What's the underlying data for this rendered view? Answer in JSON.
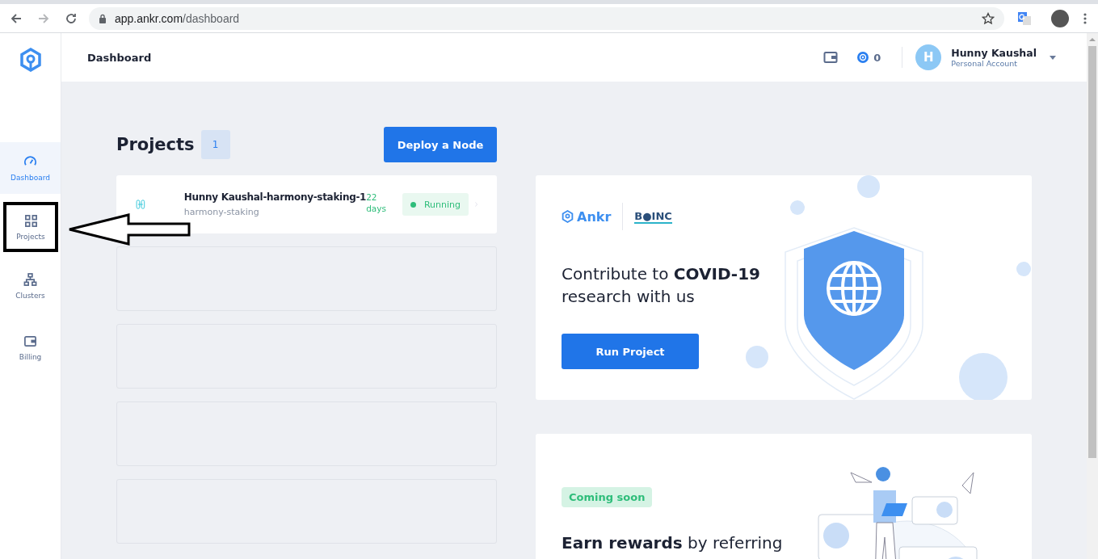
{
  "browser": {
    "url_host": "app.ankr.com",
    "url_path": "/dashboard"
  },
  "sidebar": {
    "items": [
      {
        "label": "Dashboard",
        "kind": "gauge",
        "selected": true,
        "annotated": false
      },
      {
        "label": "Projects",
        "kind": "grid",
        "selected": false,
        "annotated": true
      },
      {
        "label": "Clusters",
        "kind": "hierarchy",
        "selected": false,
        "annotated": false
      },
      {
        "label": "Billing",
        "kind": "wallet",
        "selected": false,
        "annotated": false
      }
    ]
  },
  "header": {
    "title": "Dashboard",
    "balance": "0",
    "user": {
      "initial": "H",
      "name": "Hunny Kaushal",
      "account": "Personal Account"
    }
  },
  "projects": {
    "title": "Projects",
    "count": "1",
    "deploy_button": "Deploy a Node",
    "items": [
      {
        "name": "Hunny Kaushal-harmony-staking-1",
        "type": "harmony-staking",
        "age_number": "22",
        "age_unit": "days",
        "status": "Running"
      }
    ],
    "empty_slots": [
      {
        "kind": "empty"
      },
      {
        "kind": "empty"
      },
      {
        "kind": "empty"
      },
      {
        "kind": "empty"
      }
    ]
  },
  "covid_card": {
    "partner_logos": [
      "Ankr",
      "B●INC"
    ],
    "heading": "Contribute to **COVID-19**\nresearch with us",
    "button": "Run Project"
  },
  "referral_card": {
    "badge": "Coming soon",
    "heading": "**Earn rewards** by referring"
  }
}
